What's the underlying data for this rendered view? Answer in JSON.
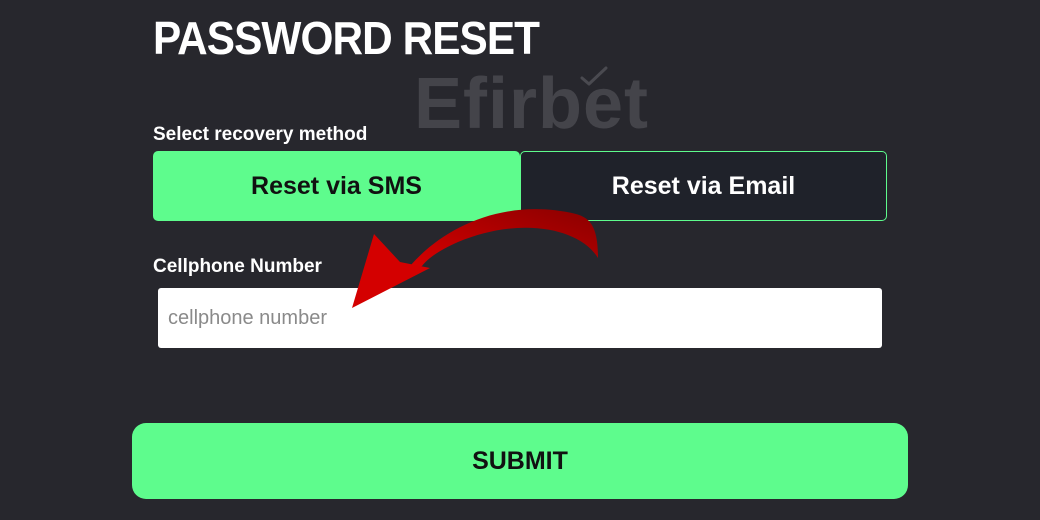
{
  "page": {
    "title": "PASSWORD RESET",
    "watermark": "Efirbet"
  },
  "form": {
    "method_label": "Select recovery method",
    "methods": [
      {
        "label": "Reset via SMS",
        "selected": true
      },
      {
        "label": "Reset via Email",
        "selected": false
      }
    ],
    "phone_label": "Cellphone Number",
    "phone_placeholder": "cellphone number",
    "phone_value": "",
    "submit_label": "SUBMIT"
  },
  "colors": {
    "background": "#27272d",
    "accent": "#5efc8d",
    "inactive_button": "#1f222a",
    "annotation_arrow": "#c80000"
  },
  "annotation": {
    "icon": "red-curved-arrow-icon"
  }
}
